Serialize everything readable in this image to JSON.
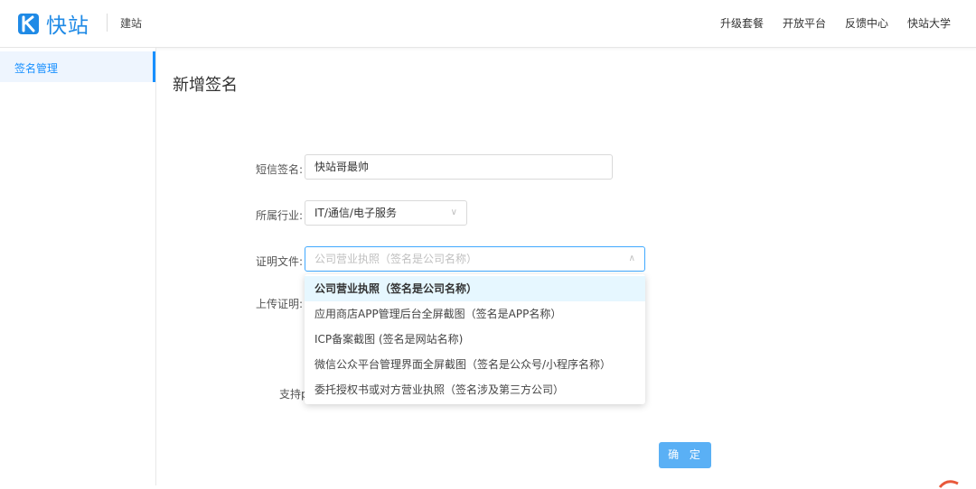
{
  "header": {
    "brand": "快站",
    "subtitle": "建站",
    "nav": [
      "升级套餐",
      "开放平台",
      "反馈中心",
      "快站大学"
    ],
    "brand_color": "#1f8ae6"
  },
  "sidebar": {
    "items": [
      {
        "label": "签名管理",
        "active": true
      }
    ],
    "accent": "#1890ff"
  },
  "page": {
    "title": "新增签名"
  },
  "form": {
    "signature": {
      "label": "短信签名:",
      "value": "快站哥最帅"
    },
    "industry": {
      "label": "所属行业:",
      "value": "IT/通信/电子服务"
    },
    "certificate": {
      "label": "证明文件:",
      "placeholder": "公司营业执照（签名是公司名称）",
      "options": [
        "公司营业执照（签名是公司名称）",
        "应用商店APP管理后台全屏截图（签名是APP名称）",
        "ICP备案截图 (签名是网站名称)",
        "微信公众平台管理界面全屏截图（签名是公众号/小程序名称）",
        "委托授权书或对方营业执照（签名涉及第三方公司）"
      ],
      "selected_index": 0
    },
    "upload": {
      "label": "上传证明:"
    },
    "support_hint": "支持p"
  },
  "actions": {
    "confirm": "确 定",
    "confirm_color": "#5ab0f5"
  }
}
